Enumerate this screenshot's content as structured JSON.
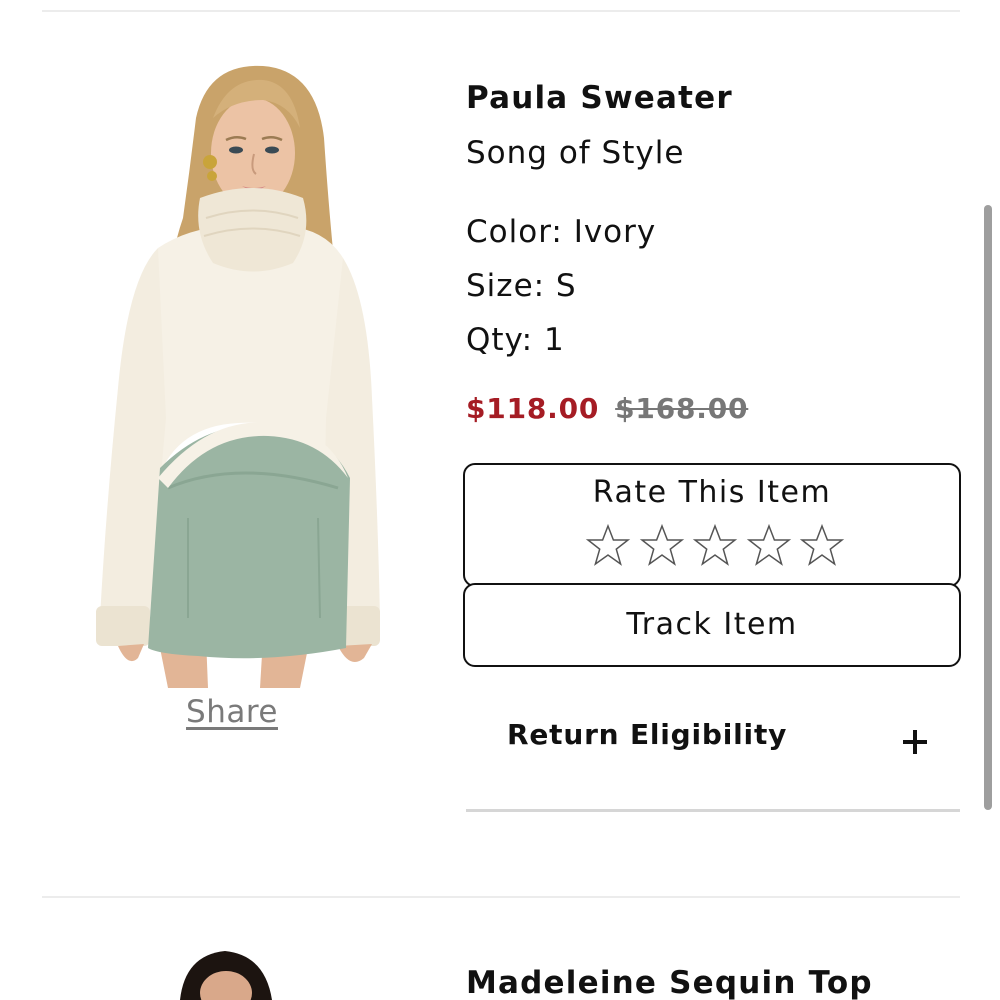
{
  "order_item": {
    "name": "Paula Sweater",
    "brand": "Song of Style",
    "color": "Color: Ivory",
    "size": "Size: S",
    "qty": "Qty: 1",
    "sale_price": "$118.00",
    "original_price": "$168.00",
    "image_alt": "Model wearing ivory turtleneck sweater and sage green velvet mini skirt",
    "share_label": "Share",
    "rating": {
      "title": "Rate This Item",
      "max_stars": 5,
      "current": 0
    },
    "track_label": "Track Item",
    "return_eligibility_label": "Return Eligibility"
  },
  "next_item": {
    "name": "Madeleine Sequin Top"
  },
  "colors": {
    "sale_price": "#a51c24",
    "original_price": "#777777",
    "text": "#111111",
    "divider": "#ececec",
    "sweater": "#f6f1e6",
    "skirt": "#9bb5a3"
  },
  "icons": {
    "star": "empty-star-icon",
    "expand": "plus-icon"
  }
}
